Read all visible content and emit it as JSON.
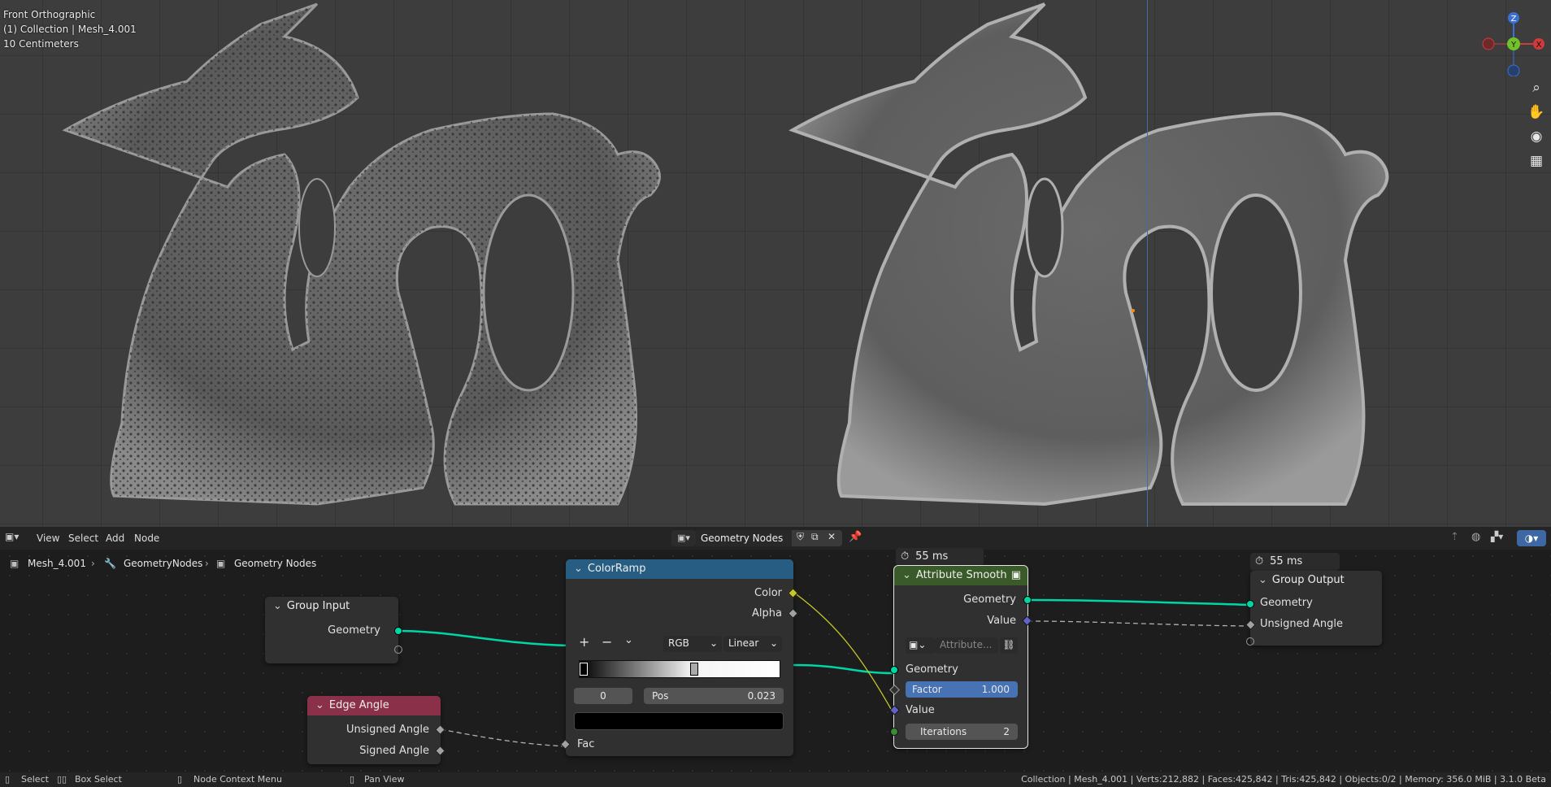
{
  "viewport": {
    "view_name": "Front Orthographic",
    "collection_line": "(1) Collection | Mesh_4.001",
    "scale_text": "10 Centimeters",
    "gizmo_axes": {
      "z": "Z",
      "y": "Y",
      "x": "X"
    }
  },
  "editor_header": {
    "menu": [
      "View",
      "Select",
      "Add",
      "Node"
    ],
    "node_tree_name": "Geometry Nodes"
  },
  "breadcrumb": {
    "object": "Mesh_4.001",
    "modifier": "GeometryNodes",
    "tree": "Geometry Nodes"
  },
  "nodes": {
    "group_input": {
      "title": "Group Input",
      "out_geometry": "Geometry"
    },
    "edge_angle": {
      "title": "Edge Angle",
      "out_unsigned": "Unsigned Angle",
      "out_signed": "Signed Angle"
    },
    "color_ramp": {
      "title": "ColorRamp",
      "out_color": "Color",
      "out_alpha": "Alpha",
      "plus": "+",
      "minus": "−",
      "color_mode": "RGB",
      "interpolation": "Linear",
      "active_index": "0",
      "pos_label": "Pos",
      "pos_value": "0.023",
      "in_fac": "Fac"
    },
    "attribute_smooth": {
      "title": "Attribute Smooth",
      "timer": "55 ms",
      "out_geometry": "Geometry",
      "out_value": "Value",
      "attribute_placeholder": "Attribute...",
      "in_geometry": "Geometry",
      "factor_label": "Factor",
      "factor_value": "1.000",
      "in_value": "Value",
      "iterations_label": "Iterations",
      "iterations_value": "2"
    },
    "group_output": {
      "title": "Group Output",
      "timer": "55 ms",
      "in_geometry": "Geometry",
      "in_unsigned": "Unsigned Angle"
    }
  },
  "status": {
    "select": "Select",
    "box_select": "Box Select",
    "context_menu": "Node Context Menu",
    "pan_view": "Pan View",
    "stats": "Collection | Mesh_4.001 | Verts:212,882 | Faces:425,842 | Tris:425,842 | Objects:0/2 | Memory: 356.0 MiB | 3.1.0 Beta"
  },
  "colors": {
    "geometry_socket": "#00d6a3",
    "float_socket": "#a1a1a1",
    "color_socket": "#c7c729",
    "vector_socket": "#6363c7",
    "int_socket": "#3a8a3a",
    "color_ramp_header": "#285d83",
    "edge_angle_header": "#8a3048",
    "attribute_smooth_header": "#3b5a2a",
    "group_header": "#303030",
    "selected_outline": "#e6e6e6"
  }
}
